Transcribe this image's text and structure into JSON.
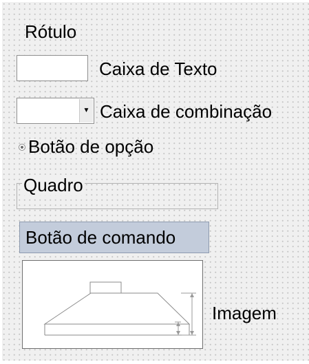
{
  "controls": {
    "label": {
      "text": "Rótulo"
    },
    "textbox": {
      "label": "Caixa de Texto",
      "value": ""
    },
    "combobox": {
      "label": "Caixa de combinação",
      "value": "",
      "arrow_icon": "dropdown-arrow-icon"
    },
    "option_button": {
      "label": "Botão de opção",
      "checked": false
    },
    "frame": {
      "caption": "Quadro"
    },
    "command_button": {
      "label": "Botão de comando"
    },
    "image": {
      "label": "Imagem",
      "content_icon": "technical-drawing-icon"
    }
  },
  "colors": {
    "background": "#f0f0f0",
    "grid_dot": "#c4c4c4",
    "command_button_fill": "#c3ccdb",
    "command_button_border": "#8d9aae"
  }
}
